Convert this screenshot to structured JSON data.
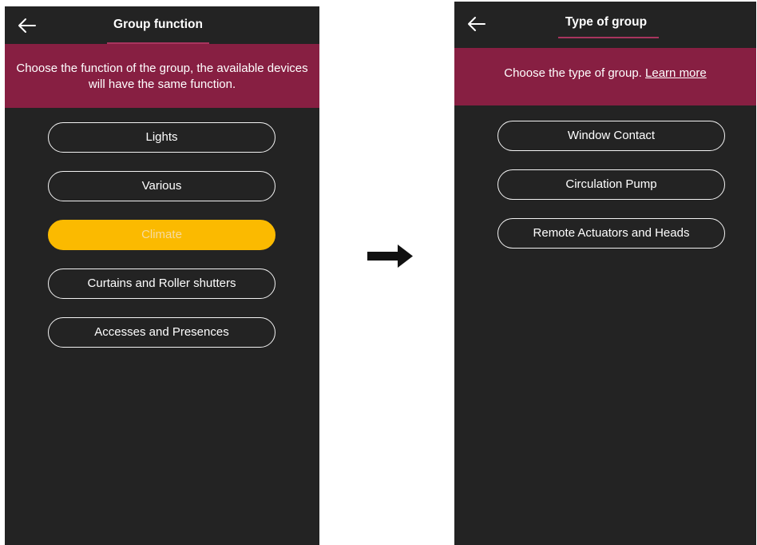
{
  "left": {
    "title": "Group function",
    "description": "Choose the function of the group, the available devices will have the same function.",
    "options": [
      "Lights",
      "Various",
      "Climate",
      "Curtains and Roller shutters",
      "Accesses and Presences"
    ],
    "selected": "Climate"
  },
  "right": {
    "title": "Type of group",
    "description": "Choose the type of group.",
    "learn_more": "Learn more",
    "options": [
      "Window Contact",
      "Circulation Pump",
      "Remote Actuators and Heads"
    ]
  },
  "colors": {
    "background": "#232323",
    "banner": "#871f42",
    "accent_underline": "#a8345e",
    "selected": "#fbba00"
  },
  "icons": {
    "back": "arrow-left-icon",
    "transition": "arrow-right-icon"
  }
}
